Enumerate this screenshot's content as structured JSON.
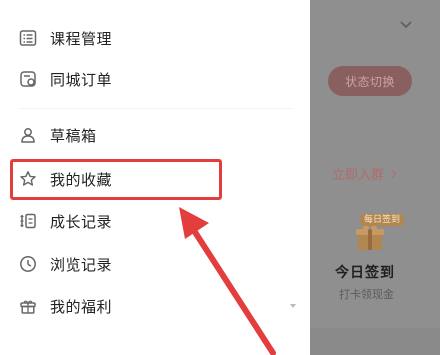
{
  "menu": {
    "items": [
      {
        "label": "课程管理",
        "icon": "list-icon"
      },
      {
        "label": "同城订单",
        "icon": "ticket-icon"
      },
      {
        "label": "草稿箱",
        "icon": "draft-icon"
      },
      {
        "label": "我的收藏",
        "icon": "star-icon"
      },
      {
        "label": "成长记录",
        "icon": "growth-record-icon"
      },
      {
        "label": "浏览记录",
        "icon": "clock-icon"
      },
      {
        "label": "我的福利",
        "icon": "gift-box-icon"
      }
    ]
  },
  "right_panel": {
    "status_toggle": "状态切换",
    "join_group": "立即入群",
    "daily_badge": "每日签到",
    "checkin_title": "今日签到",
    "checkin_subtitle": "打卡领现金"
  },
  "colors": {
    "highlight": "#e43d3d",
    "menu_text": "#222222",
    "overlay": "#8f8f8f"
  }
}
